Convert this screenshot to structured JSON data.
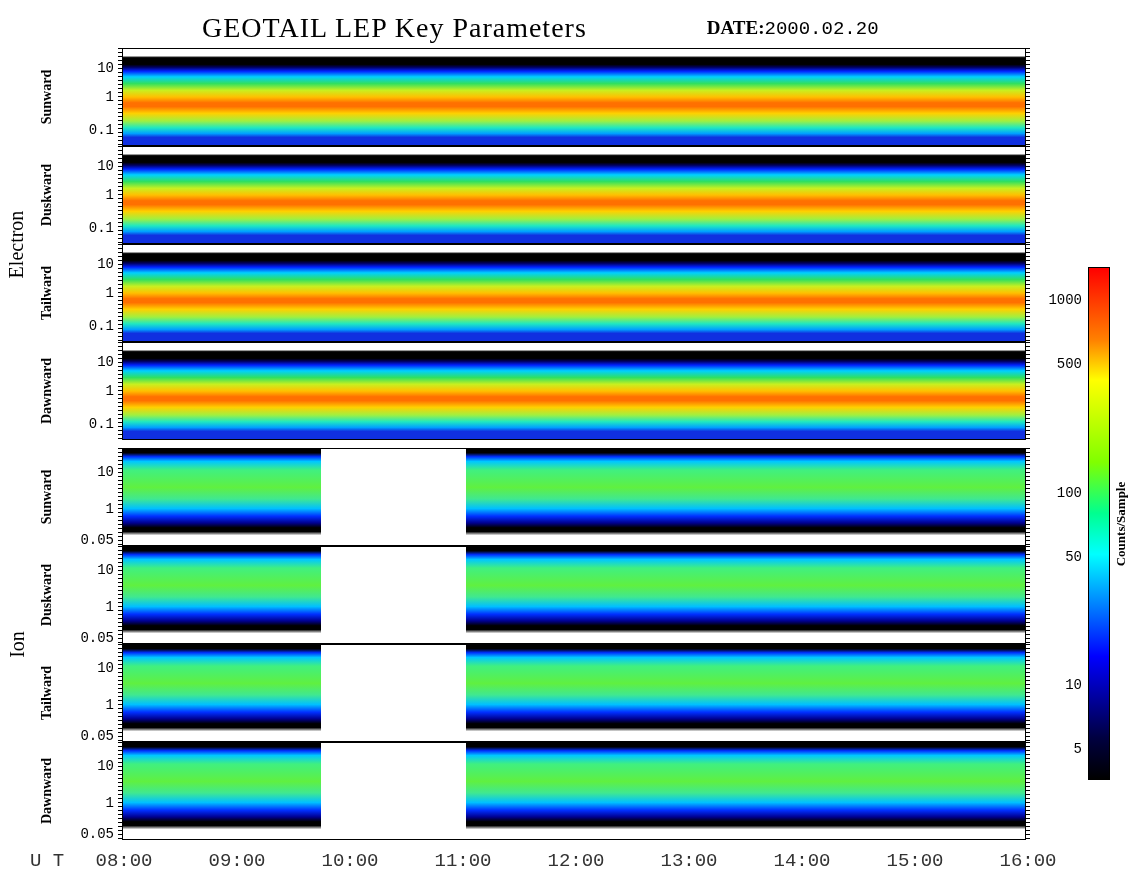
{
  "title": "GEOTAIL LEP Key Parameters",
  "date": "**DATE:**2000.02.20",
  "groups": [
    {
      "name": "Electron",
      "kind": "electron",
      "panels": [
        {
          "direction": "Sunward",
          "ticks": [
            "10",
            "1",
            "0.1"
          ]
        },
        {
          "direction": "Duskward",
          "ticks": [
            "10",
            "1",
            "0.1"
          ]
        },
        {
          "direction": "Tailward",
          "ticks": [
            "10",
            "1",
            "0.1"
          ]
        },
        {
          "direction": "Dawnward",
          "ticks": [
            "10",
            "1",
            "0.1"
          ]
        }
      ]
    },
    {
      "name": "Ion",
      "kind": "ion",
      "panels": [
        {
          "direction": "Sunward",
          "ticks": [
            "10",
            "1",
            "0.05"
          ]
        },
        {
          "direction": "Duskward",
          "ticks": [
            "10",
            "1",
            "0.05"
          ]
        },
        {
          "direction": "Tailward",
          "ticks": [
            "10",
            "1",
            "0.05"
          ]
        },
        {
          "direction": "Dawnward",
          "ticks": [
            "10",
            "1",
            "0.05"
          ]
        }
      ]
    }
  ],
  "colorbar": {
    "label": "Counts/Sample",
    "ticks": [
      "1000",
      "500",
      "100",
      "50",
      "10",
      "5"
    ]
  },
  "time_axis": {
    "label": "U T",
    "ticks": [
      "08:00",
      "09:00",
      "10:00",
      "11:00",
      "12:00",
      "13:00",
      "14:00",
      "15:00",
      "16:00"
    ]
  }
}
